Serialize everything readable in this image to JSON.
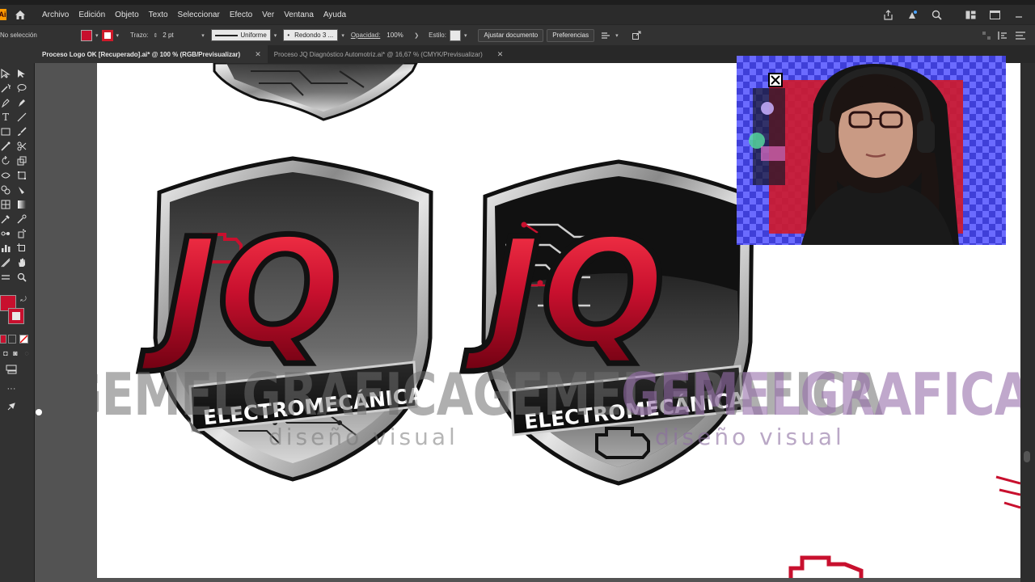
{
  "menubar": {
    "app_logo": "Ai",
    "items": [
      "Archivo",
      "Edición",
      "Objeto",
      "Texto",
      "Seleccionar",
      "Efecto",
      "Ver",
      "Ventana",
      "Ayuda"
    ]
  },
  "controlbar": {
    "selection": "No selección",
    "stroke_label": "Trazo:",
    "stroke_weight": "2 pt",
    "stroke_profile": "Uniforme",
    "brush": "Redondo 3 ...",
    "opacity_label": "Opacidad:",
    "opacity_value": "100%",
    "style_label": "Estilo:",
    "fit_button": "Ajustar documento",
    "prefs_button": "Preferencias"
  },
  "tabs": [
    {
      "label": "Proceso Logo OK [Recuperado].ai* @ 100 % (RGB/Previsualizar)",
      "active": true
    },
    {
      "label": "Proceso JQ Diagnóstico Automotriz.ai* @ 16,67 % (CMYK/Previsualizar)",
      "active": false
    }
  ],
  "artwork": {
    "logo_letters": "JQ",
    "banner_text": "ELECTROMECÁNICA",
    "watermark_brand_left": "GEMELGRAFICAGEMELGRAFICA",
    "watermark_brand_right": "GEMELGRAFICA",
    "watermark_tagline": "diseño visual"
  },
  "colors": {
    "accent_red": "#c8102e",
    "stroke_swatch": "#d01a2a",
    "ui_bg": "#323232"
  }
}
